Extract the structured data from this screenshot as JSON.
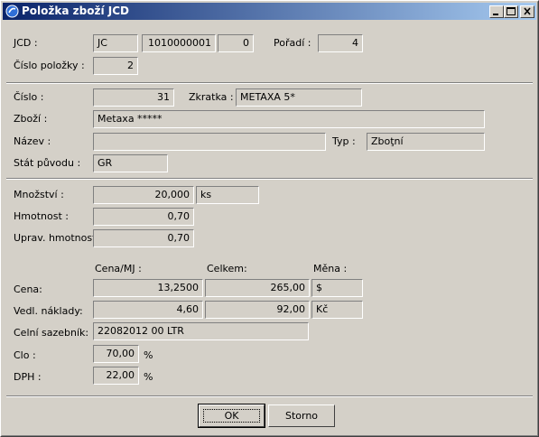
{
  "window": {
    "title": "Položka zboží JCD",
    "icon": "app-icon",
    "controls": [
      "minimize-icon",
      "maximize-icon",
      "close-icon"
    ]
  },
  "jcd": {
    "label": "JCD :",
    "type": "JC",
    "number": "1010000001",
    "suffix": "0"
  },
  "poradi": {
    "label": "Pořadí :",
    "value": "4"
  },
  "cislo_polozky": {
    "label": "Číslo položky :",
    "value": "2"
  },
  "cislo": {
    "label": "Číslo :",
    "value": "31"
  },
  "zkratka": {
    "label": "Zkratka :",
    "value": "METAXA 5*"
  },
  "zbozi": {
    "label": "Zboží :",
    "value": "Metaxa *****"
  },
  "nazev": {
    "label": "Název :",
    "value": ""
  },
  "typ": {
    "label": "Typ :",
    "value": "Zboţní"
  },
  "stat": {
    "label": "Stát původu :",
    "value": "GR"
  },
  "mnozstvi": {
    "label": "Množství :",
    "value": "20,000",
    "unit": "ks"
  },
  "hmotnost": {
    "label": "Hmotnost :",
    "value": "0,70"
  },
  "uprav_hmotnost": {
    "label": "Uprav. hmotnost :",
    "value": "0,70"
  },
  "headers": {
    "cena_mj": "Cena/MJ :",
    "celkem": "Celkem:",
    "mena": "Měna :"
  },
  "cena": {
    "label": "Cena:",
    "mj": "13,2500",
    "celkem": "265,00",
    "mena": "$"
  },
  "vedl": {
    "label": "Vedl. náklady:",
    "mj": "4,60",
    "celkem": "92,00",
    "mena": "Kč"
  },
  "celni": {
    "label": "Celní sazebník:",
    "value": "22082012 00  LTR"
  },
  "clo": {
    "label": "Clo :",
    "value": "70,00",
    "unit": "%"
  },
  "dph": {
    "label": "DPH :",
    "value": "22,00",
    "unit": "%"
  },
  "buttons": {
    "ok": "OK",
    "storno": "Storno"
  }
}
